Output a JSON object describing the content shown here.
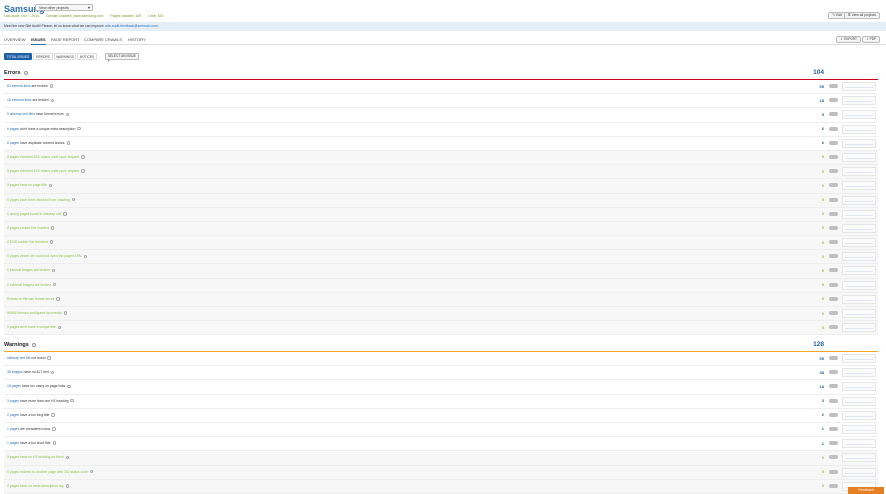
{
  "header": {
    "project": "Samsung",
    "project_select": "View other projects",
    "last_audit": "Last audit: Oct 7, 2014",
    "domain_crawled": "Domain crawled: www.samsung.com",
    "pages_crawled": "Pages crawled: 100",
    "limit": "Limit: 100",
    "edit_label": "Edit",
    "all_projects_label": "View all projects"
  },
  "infobar": {
    "text": "Meet the new Site Audit! Please, let us know what we can improve:",
    "link": "site-audit-feedback@semrush.com"
  },
  "tabs": [
    "OVERVIEW",
    "ISSUES",
    "PAGE REPORT",
    "COMPARE CRAWLS",
    "HISTORY"
  ],
  "active_tab": "ISSUES",
  "actions": {
    "export": "EXPORT",
    "pdf": "PDF"
  },
  "filters": [
    "TOTAL ISSUES",
    "ERRORS",
    "WARNINGS",
    "NOTICES"
  ],
  "select_issue": "SELECT AN ISSUE",
  "errors": {
    "title": "Errors",
    "total": "104",
    "color": "#d0021b",
    "rows": [
      {
        "link": "63 internal links",
        "text": " are broken",
        "count": "65"
      },
      {
        "link": "18 external links",
        "text": " are broken",
        "count": "18"
      },
      {
        "link": "9 sitemap.xml files",
        "text": " have format errors",
        "count": "9"
      },
      {
        "link": "6 pages",
        "text": " don't have a unique meta description",
        "count": "6"
      },
      {
        "link": "6 pages",
        "text": " have duplicate content issues",
        "count": "6"
      },
      {
        "link": "",
        "text": "0 pages returned 5XX status code upon request",
        "count": "0"
      },
      {
        "link": "",
        "text": "0 pages returned 4XX status code upon request",
        "count": "0"
      },
      {
        "link": "",
        "text": "0 pages have no page title",
        "count": "0"
      },
      {
        "link": "",
        "text": "0 pages have been blocked from crawling",
        "count": "0"
      },
      {
        "link": "",
        "text": "0 wrong pages found in sitemap.xml",
        "count": "0"
      },
      {
        "link": "",
        "text": "0 pages couldn't be crawled",
        "count": "0"
      },
      {
        "link": "",
        "text": "0 DNS couldn't be resolved",
        "count": "0"
      },
      {
        "link": "",
        "text": "0 pages where we could not open the page's URL",
        "count": "0"
      },
      {
        "link": "",
        "text": "0 internal images are broken",
        "count": "0"
      },
      {
        "link": "",
        "text": "0 external images are broken",
        "count": "0"
      },
      {
        "link": "",
        "text": "Robots.txt file has format errors",
        "count": "0"
      },
      {
        "link": "",
        "text": "WWW domain configured incorrectly",
        "count": "0"
      },
      {
        "link": "",
        "text": "0 pages don't have a unique title",
        "count": "0"
      }
    ]
  },
  "warnings": {
    "title": "Warnings",
    "total": "128",
    "color": "#f5a623",
    "rows": [
      {
        "link": "sitemap.xml file",
        "text": " not found",
        "count": "65"
      },
      {
        "link": "38 images",
        "text": " have no ALT text",
        "count": "38"
      },
      {
        "link": "18 pages",
        "text": " have too many on-page links",
        "count": "18"
      },
      {
        "link": "3 pages",
        "text": " have more than one H1 heading",
        "count": "3"
      },
      {
        "link": "2 pages",
        "text": " have a too long title",
        "count": "2"
      },
      {
        "link": "1 pages",
        "text": " are considered slow",
        "count": "1"
      },
      {
        "link": "1 pages",
        "text": " have a too short title",
        "count": "1"
      },
      {
        "link": "",
        "text": "0 pages have no H1 heading on them",
        "count": "0"
      },
      {
        "link": "",
        "text": "0 pages redirect to another page with 302 status code",
        "count": "0"
      },
      {
        "link": "",
        "text": "0 pages have no meta description tag",
        "count": "0"
      }
    ]
  },
  "feedback": "Feedback"
}
